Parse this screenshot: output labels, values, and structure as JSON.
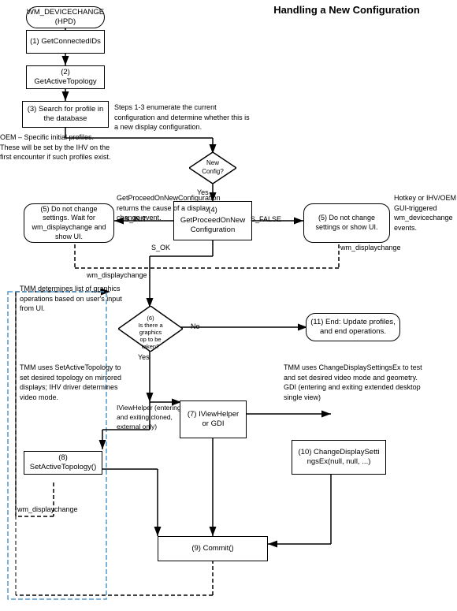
{
  "title": "Handling a New Configuration",
  "nodes": {
    "start_event": "WM_DEVICECHANGE (HPD)",
    "box1": "(1)\nGetConnectedIDs",
    "box2": "(2)\nGetActiveTopology",
    "box3": "(3)\nSearch for profile\nin the database",
    "diamond_new_config": "New\nConfiguration?",
    "box4": "(4)\nGetProceedOnNew\nConfiguration",
    "box5_left": "(5) Do not change\nsettings. Wait for\nwm_displaychange and\nshow UI.",
    "box5_right": "(5)\nDo not change\nsettings or show UI.",
    "diamond6": "(6)\nIs there a\ngraphics\noperation to be\ntaken?",
    "box7": "(7)\nIViewHelper or\nGDI",
    "box8": "(8)\nSetActiveTopology()",
    "box9": "(9)\nCommit()",
    "box10": "(10)\nChangeDisplaySetti\nngsEx(null, null, ...)",
    "box11": "(11)\nEnd: Update profiles,\nand end operations.",
    "label_yes_top": "Yes",
    "label_no_top": "",
    "label_s_init": "S_INIT",
    "label_s_false": "S_FALSE",
    "label_s_ok": "S_OK",
    "label_wm_displaychange": "wm_displaychange",
    "label_wm_displaychange2": "wm_displaychange",
    "label_yes_bottom": "Yes",
    "label_no_bottom": "No",
    "annotation1": "Steps 1-3 enumerate the\ncurrent configuration and\ndetermine whether this is a\nnew display configuration.",
    "annotation2": "OEM – Specific initial profiles. These\nwill be set by the IHV on the first\nencounter if such profiles exist.",
    "annotation3": "GetProceedOnNewConfiguration\nreturns the cause of a display\nchange event.",
    "annotation4": "Hotkey or IHV/OEM\nGUI-triggered\nwm_devicechange\nevents.",
    "annotation5": "TMM determines list of\ngraphics operations based\non user's input from UI.",
    "annotation6": "TMM uses SetActiveTopology to\nset desired topology on mirrored\ndisplays; IHV driver determines\nvideo mode.",
    "annotation7": "IViewHelper\n(entering and exiting\ncloned, external only)",
    "annotation8": "TMM uses ChangeDisplaySettingsEx\nto test and set desired video mode\nand geometry.\n\nGDI (entering and exiting\nextended desktop single view)",
    "label_wm_displaychange_bottom": "wm_displaychange"
  }
}
